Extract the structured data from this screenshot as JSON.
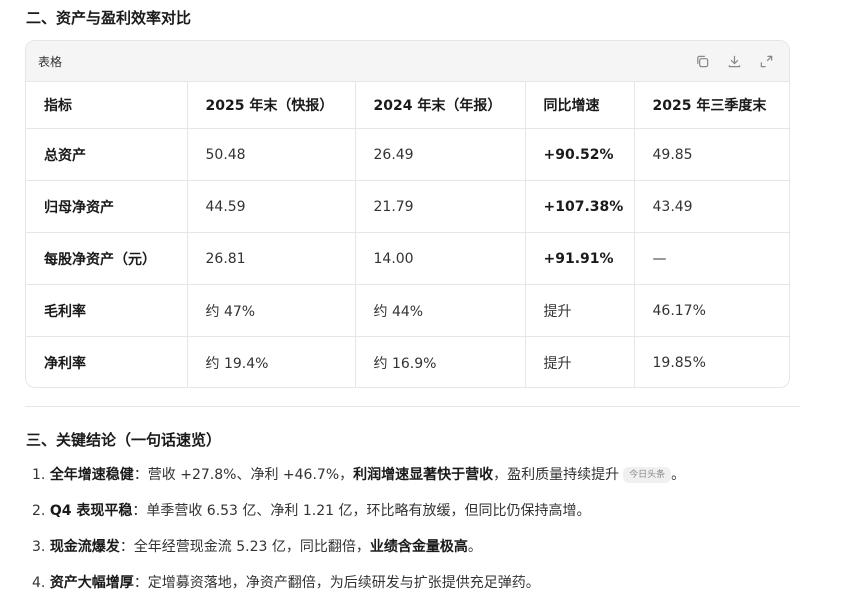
{
  "section2": {
    "title": "二、资产与盈利效率对比"
  },
  "table": {
    "label": "表格",
    "icons": [
      "copy-icon",
      "download-icon",
      "expand-icon"
    ],
    "headers": [
      "指标",
      "2025 年末（快报）",
      "2024 年末（年报）",
      "同比增速",
      "2025 年三季度末"
    ],
    "rows": [
      {
        "metric": "总资产",
        "y2025": "50.48",
        "y2024": "26.49",
        "yoy": "+90.52%",
        "q3": "49.85"
      },
      {
        "metric": "归母净资产",
        "y2025": "44.59",
        "y2024": "21.79",
        "yoy": "+107.38%",
        "q3": "43.49"
      },
      {
        "metric": "每股净资产（元）",
        "y2025": "26.81",
        "y2024": "14.00",
        "yoy": "+91.91%",
        "q3": "—"
      },
      {
        "metric": "毛利率",
        "y2025": "约 47%",
        "y2024": "约 44%",
        "yoy": "提升",
        "q3": "46.17%"
      },
      {
        "metric": "净利率",
        "y2025": "约 19.4%",
        "y2024": "约 16.9%",
        "yoy": "提升",
        "q3": "19.85%"
      }
    ]
  },
  "section3": {
    "title": "三、关键结论（一句话速览）",
    "items": [
      {
        "num": "1.",
        "bold": "全年增速稳健",
        "text1": "：营收 +27.8%、净利 +46.7%，",
        "bold2": "利润增速显著快于营收",
        "text2": "，盈利质量持续提升",
        "chip": "今日头条",
        "text3": "。"
      },
      {
        "num": "2.",
        "bold": "Q4 表现平稳",
        "text1": "：单季营收 6.53 亿、净利 1.21 亿，环比略有放缓，但同比仍保持高增。"
      },
      {
        "num": "3.",
        "bold": "现金流爆发",
        "text1": "：全年经营现金流 5.23 亿，同比翻倍，",
        "bold2": "业绩含金量极高",
        "text2": "。"
      },
      {
        "num": "4.",
        "bold": "资产大幅增厚",
        "text1": "：定增募资落地，净资产翻倍，为后续研发与扩张提供充足弹药。"
      }
    ]
  }
}
